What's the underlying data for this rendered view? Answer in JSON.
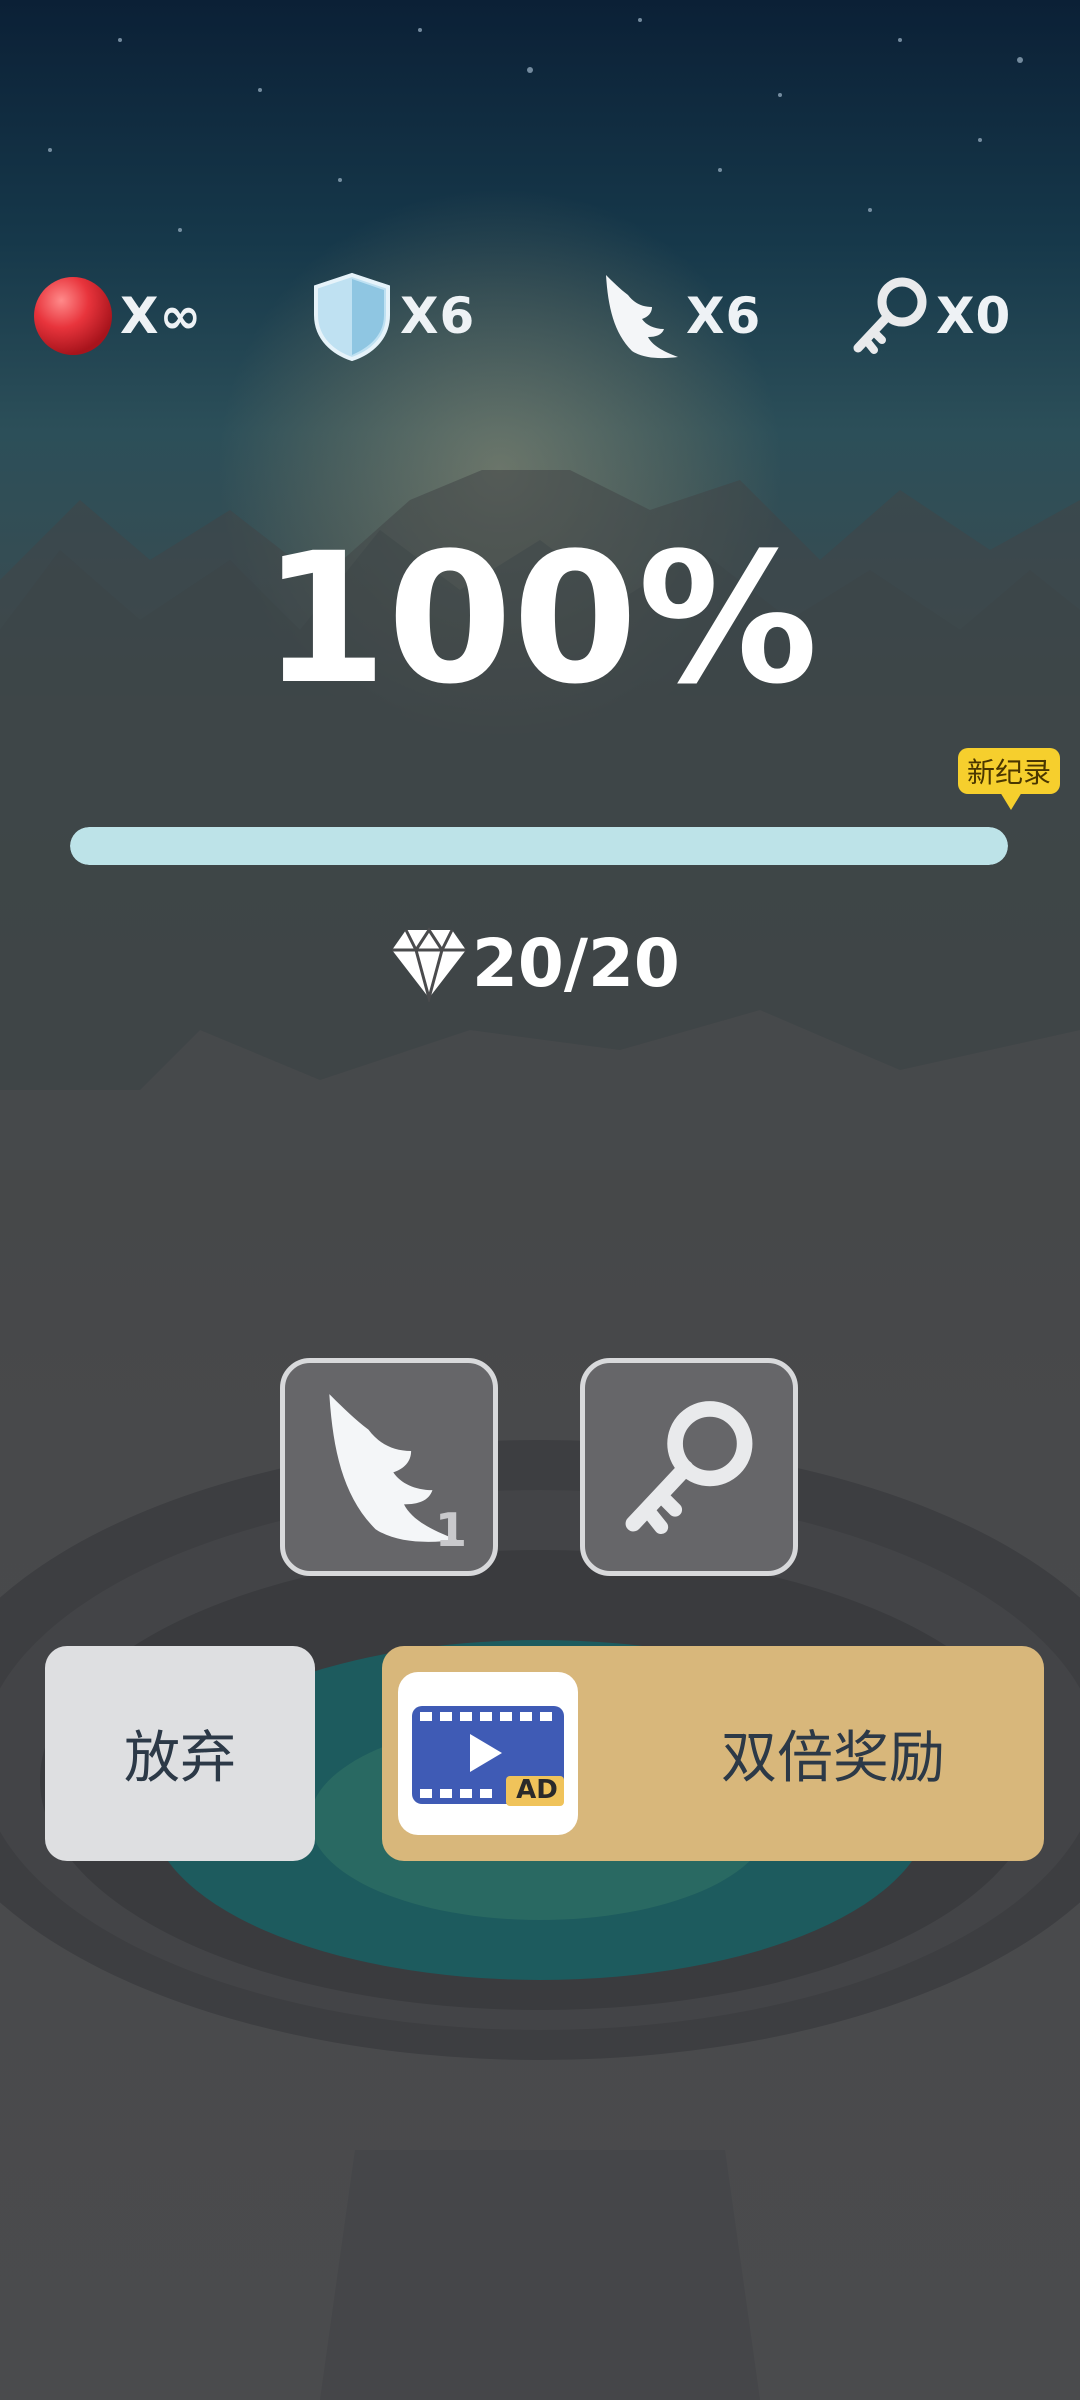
{
  "resources": {
    "lives": "X∞",
    "shields": "X6",
    "wings": "X6",
    "keys": "X0"
  },
  "progress": {
    "percent_label": "100%",
    "percent_value": 100,
    "record_badge": "新纪录"
  },
  "gems": {
    "label": "20/20",
    "collected": 20,
    "total": 20
  },
  "powerups": {
    "wing_count": "1"
  },
  "buttons": {
    "give_up": "放弃",
    "double_reward": "双倍奖励",
    "ad_badge": "AD"
  },
  "colors": {
    "progress_fill": "#bde3e8",
    "record_badge": "#f6cf2d",
    "double_button": "#d8b77b",
    "ad_icon": "#3f5bb5"
  },
  "icons": [
    "red-ball-icon",
    "shield-icon",
    "wing-icon",
    "key-icon",
    "diamond-icon",
    "video-ad-icon"
  ]
}
